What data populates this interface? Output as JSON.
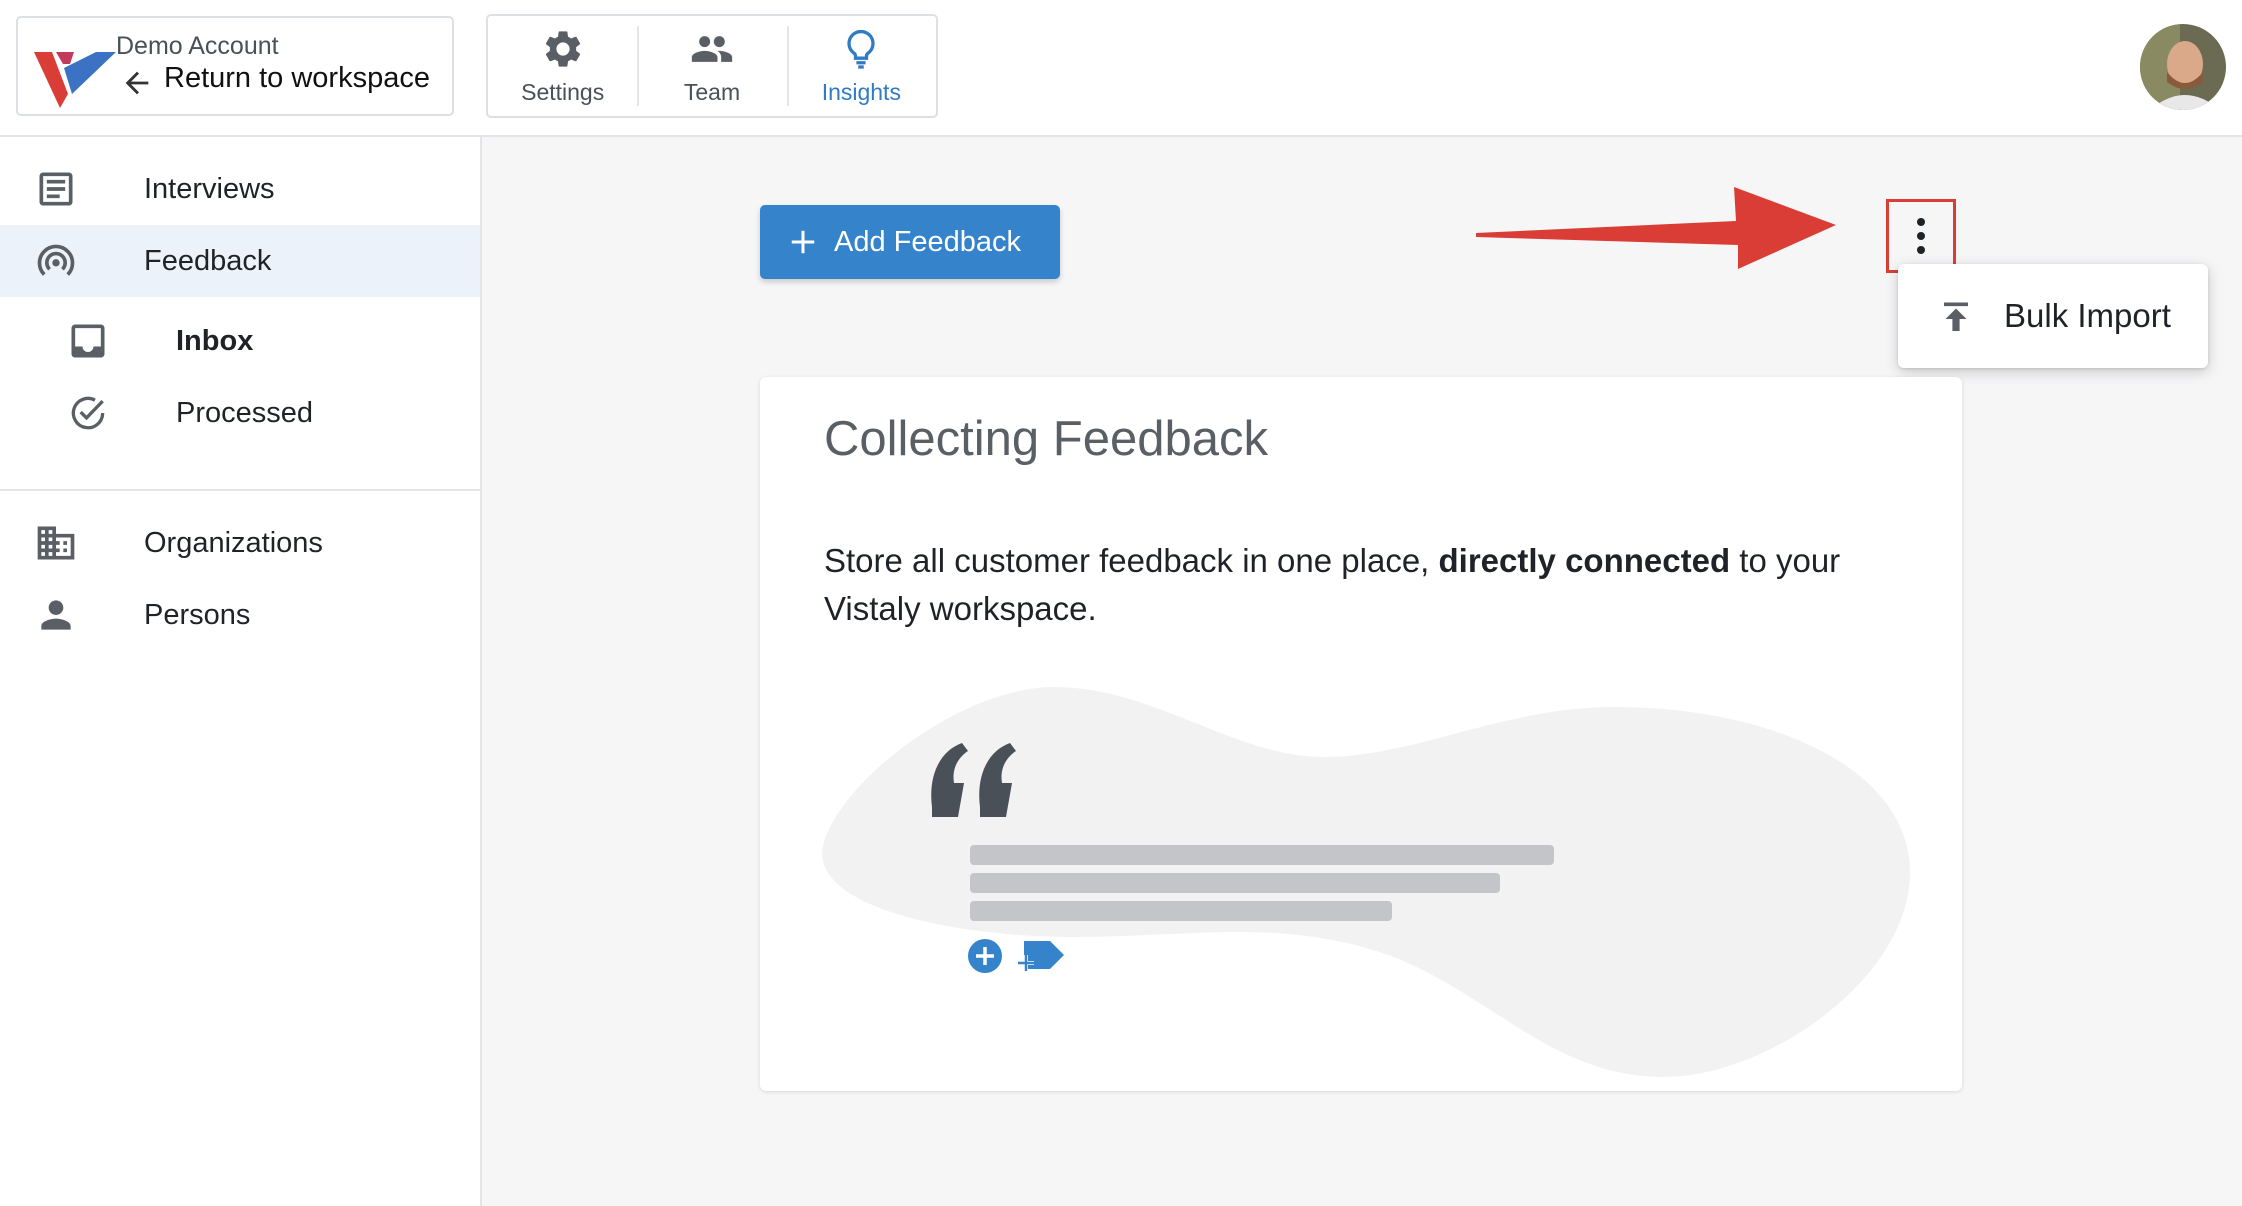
{
  "header": {
    "account_name": "Demo Account",
    "return_label": "Return to workspace",
    "tabs": [
      {
        "label": "Settings",
        "icon": "gear-icon",
        "active": false
      },
      {
        "label": "Team",
        "icon": "people-icon",
        "active": false
      },
      {
        "label": "Insights",
        "icon": "lightbulb-icon",
        "active": true
      }
    ],
    "avatar": "user-avatar"
  },
  "sidebar": {
    "items": [
      {
        "label": "Interviews",
        "icon": "document-icon"
      },
      {
        "label": "Feedback",
        "icon": "broadcast-icon",
        "active": true
      },
      {
        "label": "Inbox",
        "icon": "inbox-icon",
        "bold": true
      },
      {
        "label": "Processed",
        "icon": "check-circle-icon"
      },
      {
        "label": "Organizations",
        "icon": "building-icon"
      },
      {
        "label": "Persons",
        "icon": "person-icon"
      }
    ]
  },
  "main": {
    "add_button_label": "Add Feedback",
    "menu": {
      "items": [
        {
          "label": "Bulk Import",
          "icon": "upload-icon"
        }
      ]
    },
    "card": {
      "title": "Collecting Feedback",
      "desc_part1": "Store all customer feedback in one place, ",
      "desc_bold": "directly connected",
      "desc_part2": " to your Vistaly workspace."
    }
  },
  "colors": {
    "brand_blue": "#3483cb",
    "brand_red": "#d93d35",
    "active_bg": "#ebf2fa",
    "main_bg": "#f6f6f7"
  }
}
